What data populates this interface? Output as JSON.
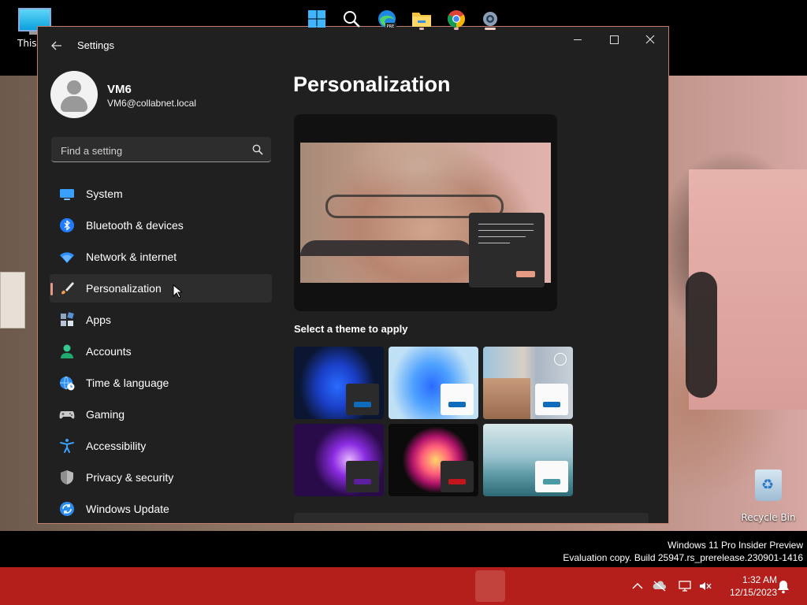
{
  "desktop": {
    "icons": [
      {
        "label": "This PC"
      },
      {
        "label": "Recycle Bin"
      }
    ],
    "watermark": {
      "line1": "Windows 11 Pro Insider Preview",
      "line2": "Evaluation copy. Build 25947.rs_prerelease.230901-1416"
    }
  },
  "window": {
    "title": "Settings",
    "profile": {
      "name": "VM6",
      "email": "VM6@collabnet.local"
    },
    "search": {
      "placeholder": "Find a setting"
    },
    "nav": [
      {
        "label": "System",
        "icon": "monitor-icon"
      },
      {
        "label": "Bluetooth & devices",
        "icon": "bluetooth-icon"
      },
      {
        "label": "Network & internet",
        "icon": "wifi-icon"
      },
      {
        "label": "Personalization",
        "icon": "paintbrush-icon",
        "selected": true
      },
      {
        "label": "Apps",
        "icon": "apps-icon"
      },
      {
        "label": "Accounts",
        "icon": "person-icon"
      },
      {
        "label": "Time & language",
        "icon": "globe-clock-icon"
      },
      {
        "label": "Gaming",
        "icon": "gamepad-icon"
      },
      {
        "label": "Accessibility",
        "icon": "accessibility-icon"
      },
      {
        "label": "Privacy & security",
        "icon": "shield-icon"
      },
      {
        "label": "Windows Update",
        "icon": "update-icon"
      }
    ],
    "main": {
      "title": "Personalization",
      "theme_heading": "Select a theme to apply",
      "themes": [
        {
          "name": "windows-dark",
          "accent": "#0f6cbd"
        },
        {
          "name": "windows-light",
          "accent": "#0f6cbd"
        },
        {
          "name": "glow-flower",
          "accent": "#0f6cbd"
        },
        {
          "name": "glow-purple",
          "accent": "#5b1fa0"
        },
        {
          "name": "captured-motion",
          "accent": "#c4141c"
        },
        {
          "name": "flow-lake",
          "accent": "#4a9aa5"
        }
      ]
    }
  },
  "taskbar": {
    "clock": {
      "time": "1:32 AM",
      "date": "12/15/2023"
    }
  },
  "colors": {
    "accent": "#e39a87",
    "taskbar": "#b41f1c",
    "window_bg": "#202020"
  }
}
